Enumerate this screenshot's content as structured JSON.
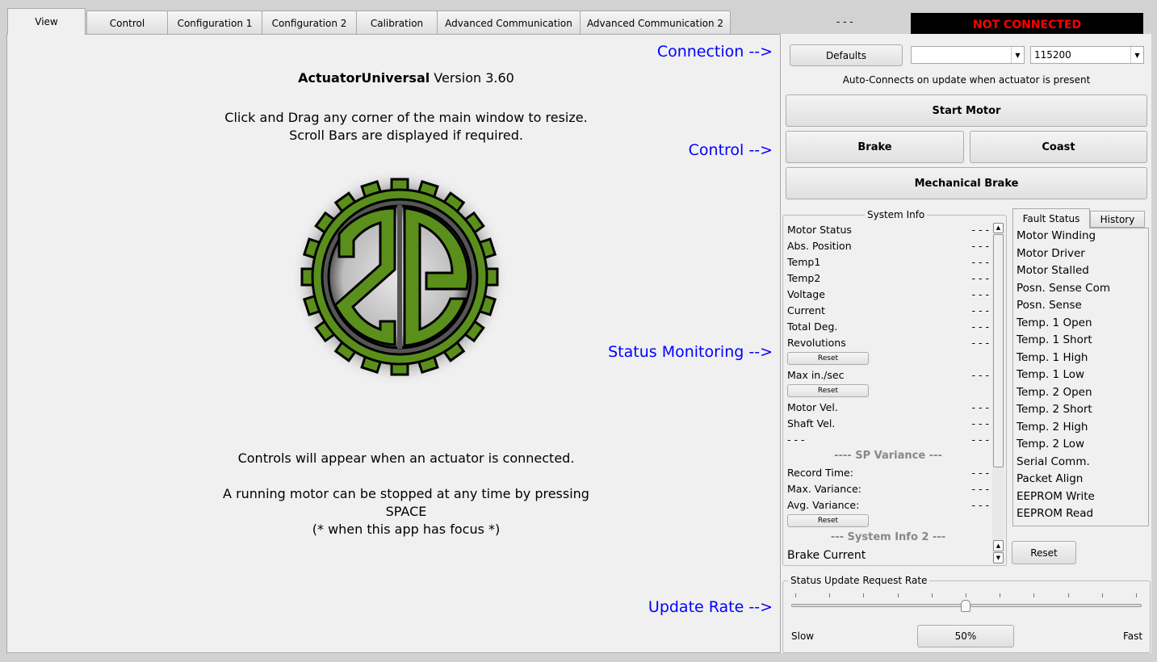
{
  "tabs": [
    "View",
    "Control",
    "Configuration 1",
    "Configuration 2",
    "Calibration",
    "Advanced Communication",
    "Advanced Communication 2"
  ],
  "header": {
    "status_placeholder": "- - -",
    "connection_status": "NOT CONNECTED",
    "connection_status_color": "#ff0000"
  },
  "main": {
    "title_bold": "ActuatorUniversal",
    "title_rest": " Version 3.60",
    "resize_line1": "Click and Drag any corner of the main window to resize.",
    "resize_line2": "Scroll Bars are displayed if required.",
    "controls_note": "Controls will appear when an actuator is connected.",
    "stop_line1": "A running motor can be stopped at any time by pressing",
    "stop_line2": "SPACE",
    "stop_line3": "(* when this app has focus *)",
    "logo_text": "2G"
  },
  "pointers": {
    "connection": "Connection -->",
    "control": "Control -->",
    "status": "Status Monitoring -->",
    "update": "Update Rate -->"
  },
  "connection": {
    "defaults": "Defaults",
    "port_value": "",
    "baud_value": "115200",
    "auto_note": "Auto-Connects on update when actuator is present"
  },
  "control": {
    "start": "Start Motor",
    "brake": "Brake",
    "coast": "Coast",
    "mech_brake": "Mechanical Brake"
  },
  "system_info": {
    "title": "System Info",
    "rows": [
      {
        "label": "Motor Status",
        "value": "- - -"
      },
      {
        "label": "Abs. Position",
        "value": "- - -"
      },
      {
        "label": "Temp1",
        "value": "- - -"
      },
      {
        "label": "Temp2",
        "value": "- - -"
      },
      {
        "label": "Voltage",
        "value": "- - -"
      },
      {
        "label": "Current",
        "value": "- - -"
      },
      {
        "label": "Total Deg.",
        "value": "- - -"
      },
      {
        "label": "Revolutions",
        "value": "- - -"
      },
      {
        "label": "Max in./sec",
        "value": "- - -"
      },
      {
        "label": "Motor Vel.",
        "value": "- - -"
      },
      {
        "label": "Shaft Vel.",
        "value": "- - -"
      },
      {
        "label": "- - -",
        "value": "- - -"
      },
      {
        "label": "Record Time:",
        "value": "- - -"
      },
      {
        "label": "Max. Variance:",
        "value": "- - -"
      },
      {
        "label": "Avg. Variance:",
        "value": "- - -"
      },
      {
        "label": "Brake Current",
        "value": ""
      }
    ],
    "reset": "Reset",
    "sp_variance": "---- SP Variance ---",
    "system_info_2": "--- System Info 2 ---"
  },
  "fault": {
    "tabs": [
      "Fault Status",
      "History"
    ],
    "items": [
      "Motor Winding",
      "Motor Driver",
      "Motor Stalled",
      "Posn. Sense Com",
      "Posn. Sense",
      "Temp. 1 Open",
      "Temp. 1 Short",
      "Temp. 1 High",
      "Temp. 1 Low",
      "Temp. 2 Open",
      "Temp. 2 Short",
      "Temp. 2 High",
      "Temp. 2 Low",
      "Serial Comm.",
      "Packet Align",
      "EEPROM Write",
      "EEPROM Read"
    ],
    "reset": "Reset"
  },
  "update_rate": {
    "title": "Status Update Request Rate",
    "slow": "Slow",
    "fast": "Fast",
    "value_label": "50%",
    "value_percent": 50
  }
}
